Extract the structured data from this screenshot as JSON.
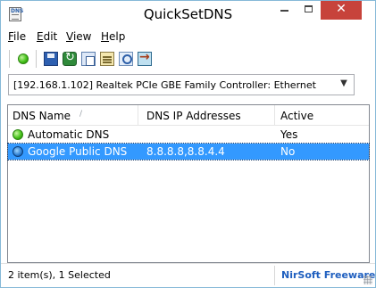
{
  "window": {
    "title": "QuickSetDNS",
    "icon_label": "DNS",
    "controls": {
      "minimize": "minimize-icon",
      "maximize": "maximize-icon",
      "close_glyph": "✕"
    }
  },
  "menu": [
    {
      "label": "File",
      "accel": "F",
      "rest": "ile"
    },
    {
      "label": "Edit",
      "accel": "E",
      "rest": "dit"
    },
    {
      "label": "View",
      "accel": "V",
      "rest": "iew"
    },
    {
      "label": "Help",
      "accel": "H",
      "rest": "elp"
    }
  ],
  "toolbar": {
    "icons": [
      "set-dns-icon",
      "save-icon",
      "refresh-icon",
      "copy-icon",
      "properties-icon",
      "find-icon",
      "exit-icon"
    ]
  },
  "adapter_select": {
    "value": "[192.168.1.102]  Realtek PCIe GBE Family Controller: Ethernet"
  },
  "list": {
    "columns": [
      "DNS Name",
      "DNS IP Addresses",
      "Active"
    ],
    "rows": [
      {
        "name": "Automatic DNS",
        "ips": "",
        "active": "Yes",
        "icon": "green-dot-icon",
        "selected": false
      },
      {
        "name": "Google Public DNS",
        "ips": "8.8.8.8,8.8.4.4",
        "active": "No",
        "icon": "globe-icon",
        "selected": true
      }
    ]
  },
  "status": {
    "summary": "2 item(s), 1 Selected",
    "brand": "NirSoft Freeware."
  },
  "colors": {
    "selection": "#3399ff",
    "close_button": "#c7433b",
    "brand_link": "#1f5fbf"
  }
}
